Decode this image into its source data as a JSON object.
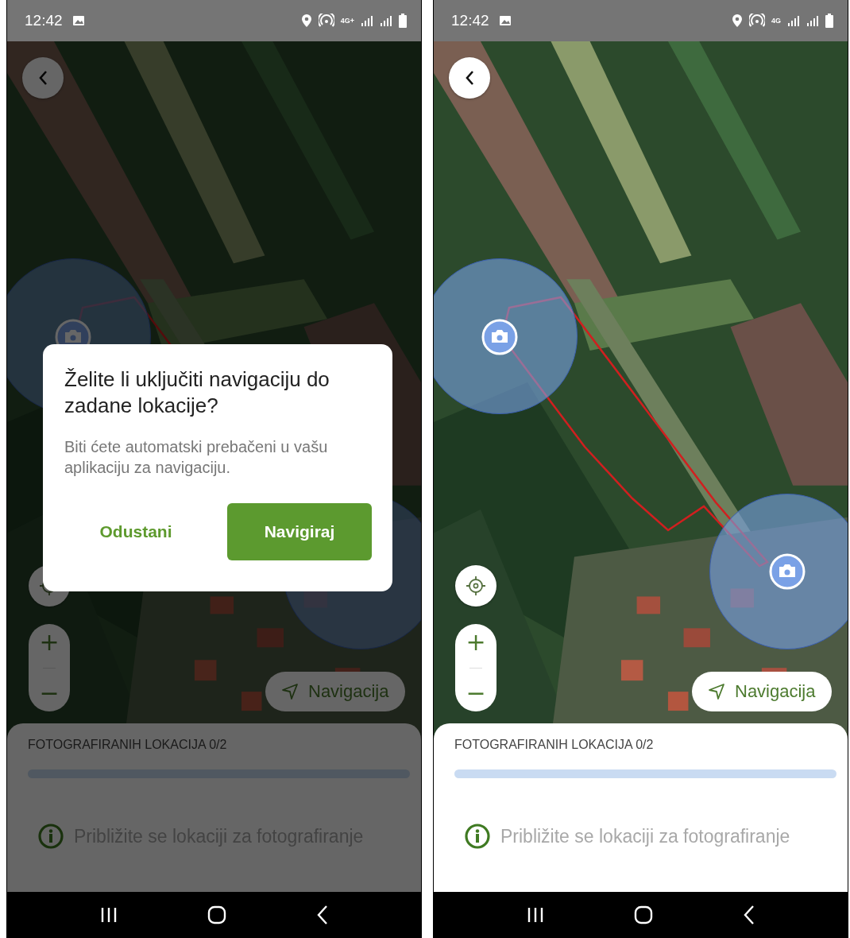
{
  "screens": [
    {
      "status_bar": {
        "time": "12:42",
        "network_type": "4G+"
      },
      "zoom_in": "+",
      "zoom_out": "−",
      "navigation_button": "Navigacija",
      "progress": {
        "title": "FOTOGRAFIRANIH LOKACIJA 0/2",
        "level": 0
      },
      "hint": "Približite se lokaciji za fotografiranje",
      "dialog": {
        "title": "Želite li uključiti navigaciju do zadane lokacije?",
        "message": "Biti ćete automatski prebačeni u vašu aplikaciju za navigaciju.",
        "buttons": [
          {
            "label": "Odustani",
            "kind": "text"
          },
          {
            "label": "Navigiraj",
            "kind": "filled"
          }
        ]
      }
    },
    {
      "status_bar": {
        "time": "12:42",
        "network_type": "4G"
      },
      "zoom_in": "+",
      "zoom_out": "−",
      "navigation_button": "Navigacija",
      "progress": {
        "title": "FOTOGRAFIRANIH LOKACIJA 0/2",
        "level": 0
      },
      "hint": "Približite se lokaciji za fotografiranje"
    }
  ]
}
